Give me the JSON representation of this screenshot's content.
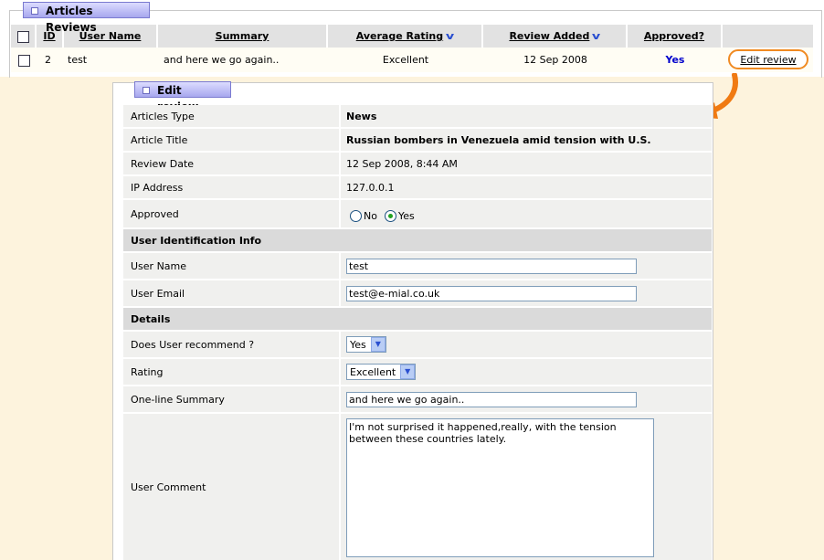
{
  "list_panel": {
    "title": "Articles Reviews",
    "headers": {
      "id": "ID",
      "user_name": "User Name",
      "summary": "Summary",
      "average_rating": "Average Rating",
      "review_added": "Review Added",
      "approved": "Approved?"
    },
    "row": {
      "id": "2",
      "user_name": "test",
      "summary": "and here we go again..",
      "average_rating": "Excellent",
      "review_added": "12 Sep 2008",
      "approved": "Yes",
      "edit_link": "Edit review"
    },
    "approved_color": "#0000cc"
  },
  "edit_form": {
    "title": "Edit review",
    "fields": {
      "articles_type": {
        "label": "Articles Type",
        "value": "News"
      },
      "article_title": {
        "label": "Article Title",
        "value": "Russian bombers in Venezuela amid tension with U.S."
      },
      "review_date": {
        "label": "Review Date",
        "value": "12 Sep 2008, 8:44 AM"
      },
      "ip_address": {
        "label": "IP Address",
        "value": "127.0.0.1"
      },
      "approved": {
        "label": "Approved",
        "option_no": "No",
        "option_yes": "Yes",
        "selected": "Yes"
      }
    },
    "section_user": "User Identification Info",
    "user_name": {
      "label": "User Name",
      "value": "test"
    },
    "user_email": {
      "label": "User Email",
      "value": "test@e-mial.co.uk"
    },
    "section_details": "Details",
    "recommend": {
      "label": "Does User recommend ?",
      "value": "Yes"
    },
    "rating": {
      "label": "Rating",
      "value": "Excellent"
    },
    "summary": {
      "label": "One-line Summary",
      "value": "and here we go again.."
    },
    "comment": {
      "label": "User Comment",
      "value": "I'm not surprised it happened,really, with the tension between these countries lately."
    }
  },
  "accent_color": "#f08a22",
  "icons": {
    "sort_down": "sort-descending-icon",
    "arrow": "curved-arrow-icon"
  }
}
